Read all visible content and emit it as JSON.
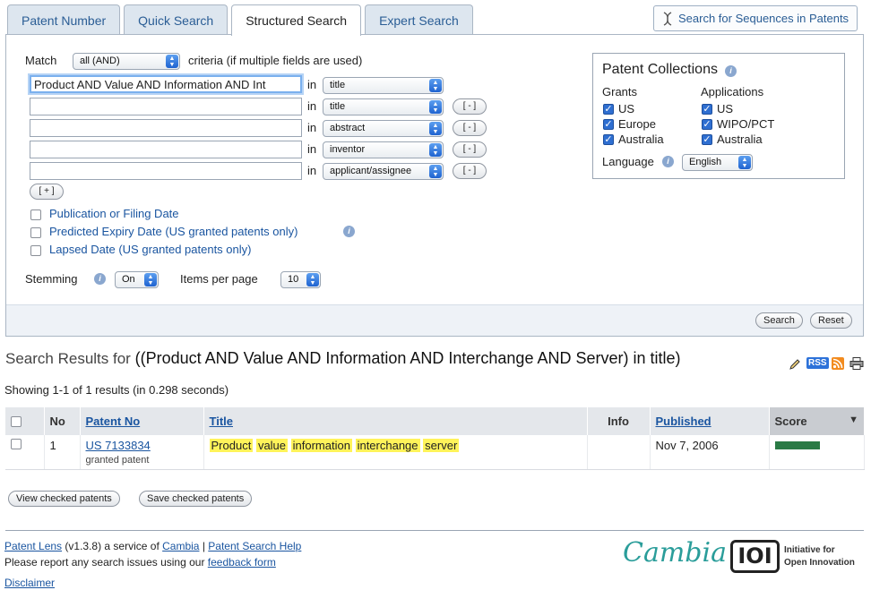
{
  "tabs": [
    "Patent Number",
    "Quick Search",
    "Structured Search",
    "Expert Search"
  ],
  "active_tab": "Structured Search",
  "sequence_button": "Search for Sequences in Patents",
  "match": {
    "label": "Match",
    "value": "all (AND)",
    "suffix": "criteria (if multiple fields are used)"
  },
  "in_label": "in",
  "criteria": [
    {
      "value": "Product AND Value AND Information AND Int",
      "field": "title",
      "remove": ""
    },
    {
      "value": "",
      "field": "title",
      "remove": "[ - ]"
    },
    {
      "value": "",
      "field": "abstract",
      "remove": "[ - ]"
    },
    {
      "value": "",
      "field": "inventor",
      "remove": "[ - ]"
    },
    {
      "value": "",
      "field": "applicant/assignee",
      "remove": "[ - ]"
    }
  ],
  "add_button": "[ + ]",
  "date_options": [
    "Publication or Filing Date",
    "Predicted Expiry Date (US granted patents only)",
    "Lapsed Date (US granted patents only)"
  ],
  "stemming": {
    "label": "Stemming",
    "value": "On"
  },
  "items_per_page": {
    "label": "Items per page",
    "value": "10"
  },
  "collections": {
    "title": "Patent Collections",
    "grants_label": "Grants",
    "grants": [
      "US",
      "Europe",
      "Australia"
    ],
    "applications_label": "Applications",
    "applications": [
      "US",
      "WIPO/PCT",
      "Australia"
    ],
    "language_label": "Language",
    "language_value": "English"
  },
  "search_button": "Search",
  "reset_button": "Reset",
  "results": {
    "heading": "Search Results for",
    "query": "((Product AND Value AND Information AND Interchange AND Server) in title)",
    "rss": "RSS",
    "showing": "Showing 1-1 of 1 results (in 0.298 seconds)",
    "columns": [
      "No",
      "Patent No",
      "Title",
      "Info",
      "Published",
      "Score"
    ],
    "rows": [
      {
        "no": "1",
        "patent_no": "US 7133834",
        "status": "granted patent",
        "title_words": [
          "Product",
          "value",
          "information",
          "interchange",
          "server"
        ],
        "info": "",
        "published": "Nov 7, 2006",
        "score": 1.0
      }
    ]
  },
  "view_checked": "View checked patents",
  "save_checked": "Save checked patents",
  "footer": {
    "patent_lens": "Patent Lens",
    "version": "(v1.3.8) a service of",
    "cambia_link": "Cambia",
    "sep": "|",
    "help": "Patent Search Help",
    "report": "Please report any search issues using our",
    "feedback": "feedback form",
    "disclaimer": "Disclaimer",
    "cambia_logo": "Cambia",
    "ioi_logo": "IOI",
    "ioi_text1": "Initiative for",
    "ioi_text2": "Open Innovation"
  }
}
